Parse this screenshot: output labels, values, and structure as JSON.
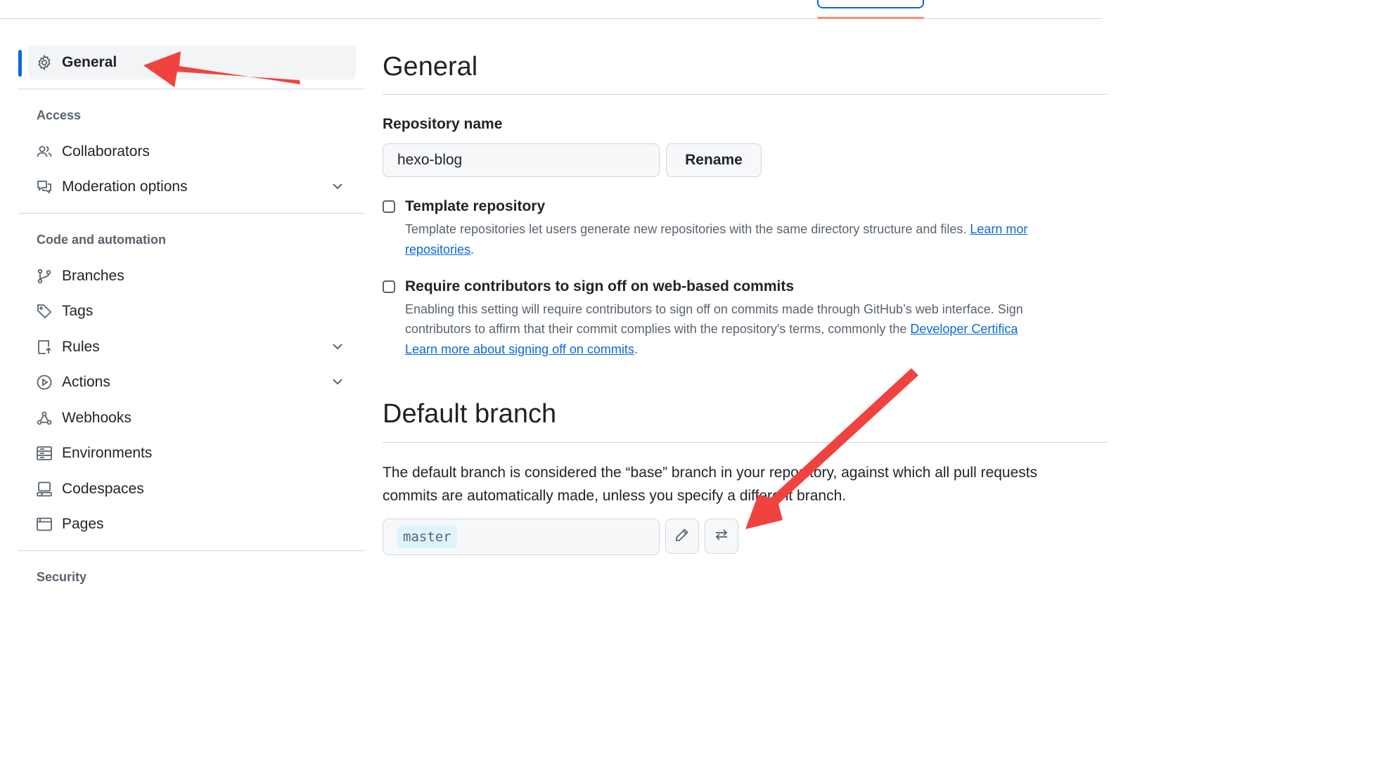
{
  "sidebar": {
    "general_label": "General",
    "sections": {
      "access": "Access",
      "code_automation": "Code and automation",
      "security": "Security"
    },
    "items": {
      "collaborators": "Collaborators",
      "moderation": "Moderation options",
      "branches": "Branches",
      "tags": "Tags",
      "rules": "Rules",
      "actions": "Actions",
      "webhooks": "Webhooks",
      "environments": "Environments",
      "codespaces": "Codespaces",
      "pages": "Pages"
    }
  },
  "main": {
    "title": "General",
    "repo_name_label": "Repository name",
    "repo_name_value": "hexo-blog",
    "rename_button": "Rename",
    "template": {
      "title": "Template repository",
      "desc_line1": "Template repositories let users generate new repositories with the same directory structure and files. ",
      "link1": "Learn mor",
      "link2": "repositories",
      "desc_end": "."
    },
    "signoff": {
      "title": "Require contributors to sign off on web-based commits",
      "desc_line1": "Enabling this setting will require contributors to sign off on commits made through GitHub’s web interface. Sign",
      "desc_line2": "contributors to affirm that their commit complies with the repository's terms, commonly the ",
      "link_dco": "Developer Certifica",
      "link_learn": "Learn more about signing off on commits",
      "desc_end": "."
    },
    "default_branch": {
      "title": "Default branch",
      "para_line1": "The default branch is considered the “base” branch in your repository, against which all pull requests",
      "para_line2": "commits are automatically made, unless you specify a different branch.",
      "branch_value": "master"
    }
  },
  "icons": {
    "general": "gear-icon",
    "collaborators": "people-icon",
    "moderation": "comment-discussion-icon",
    "branches": "git-branch-icon",
    "tags": "tag-icon",
    "rules": "repo-push-icon",
    "actions": "play-icon",
    "webhooks": "webhook-icon",
    "environments": "server-icon",
    "codespaces": "codespaces-icon",
    "pages": "browser-icon",
    "edit": "pencil-icon",
    "switch": "arrow-switch-icon"
  },
  "colors": {
    "accent": "#0969da",
    "annotation_arrow": "#f0433f",
    "tab_underline": "#fd8c73"
  }
}
